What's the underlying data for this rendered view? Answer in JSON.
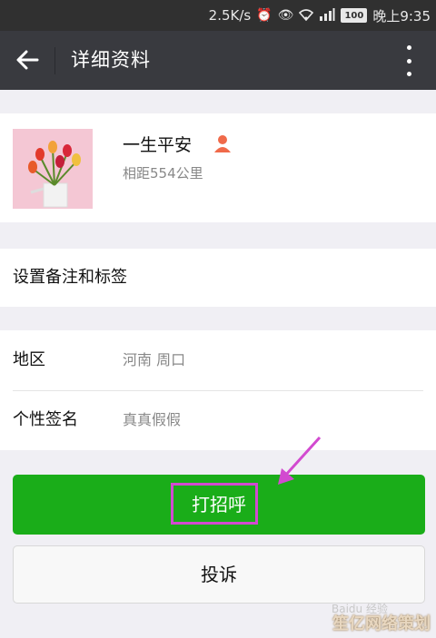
{
  "status_bar": {
    "speed": "2.5K/s",
    "battery": "100",
    "time": "晚上9:35"
  },
  "header": {
    "title": "详细资料"
  },
  "profile": {
    "name": "一生平安",
    "distance": "相距554公里"
  },
  "remark": {
    "label": "设置备注和标签"
  },
  "info": {
    "rows": [
      {
        "key": "地区",
        "value": "河南  周口"
      },
      {
        "key": "个性签名",
        "value": "真真假假"
      }
    ]
  },
  "actions": {
    "greet_label": "打招呼",
    "report_label": "投诉"
  },
  "watermark": {
    "text": "笙亿网络策划",
    "baidu": "Baidu 经验"
  },
  "colors": {
    "accent_green": "#1aad19",
    "header_bg": "#393a3f",
    "highlight": "#d24ad0"
  }
}
